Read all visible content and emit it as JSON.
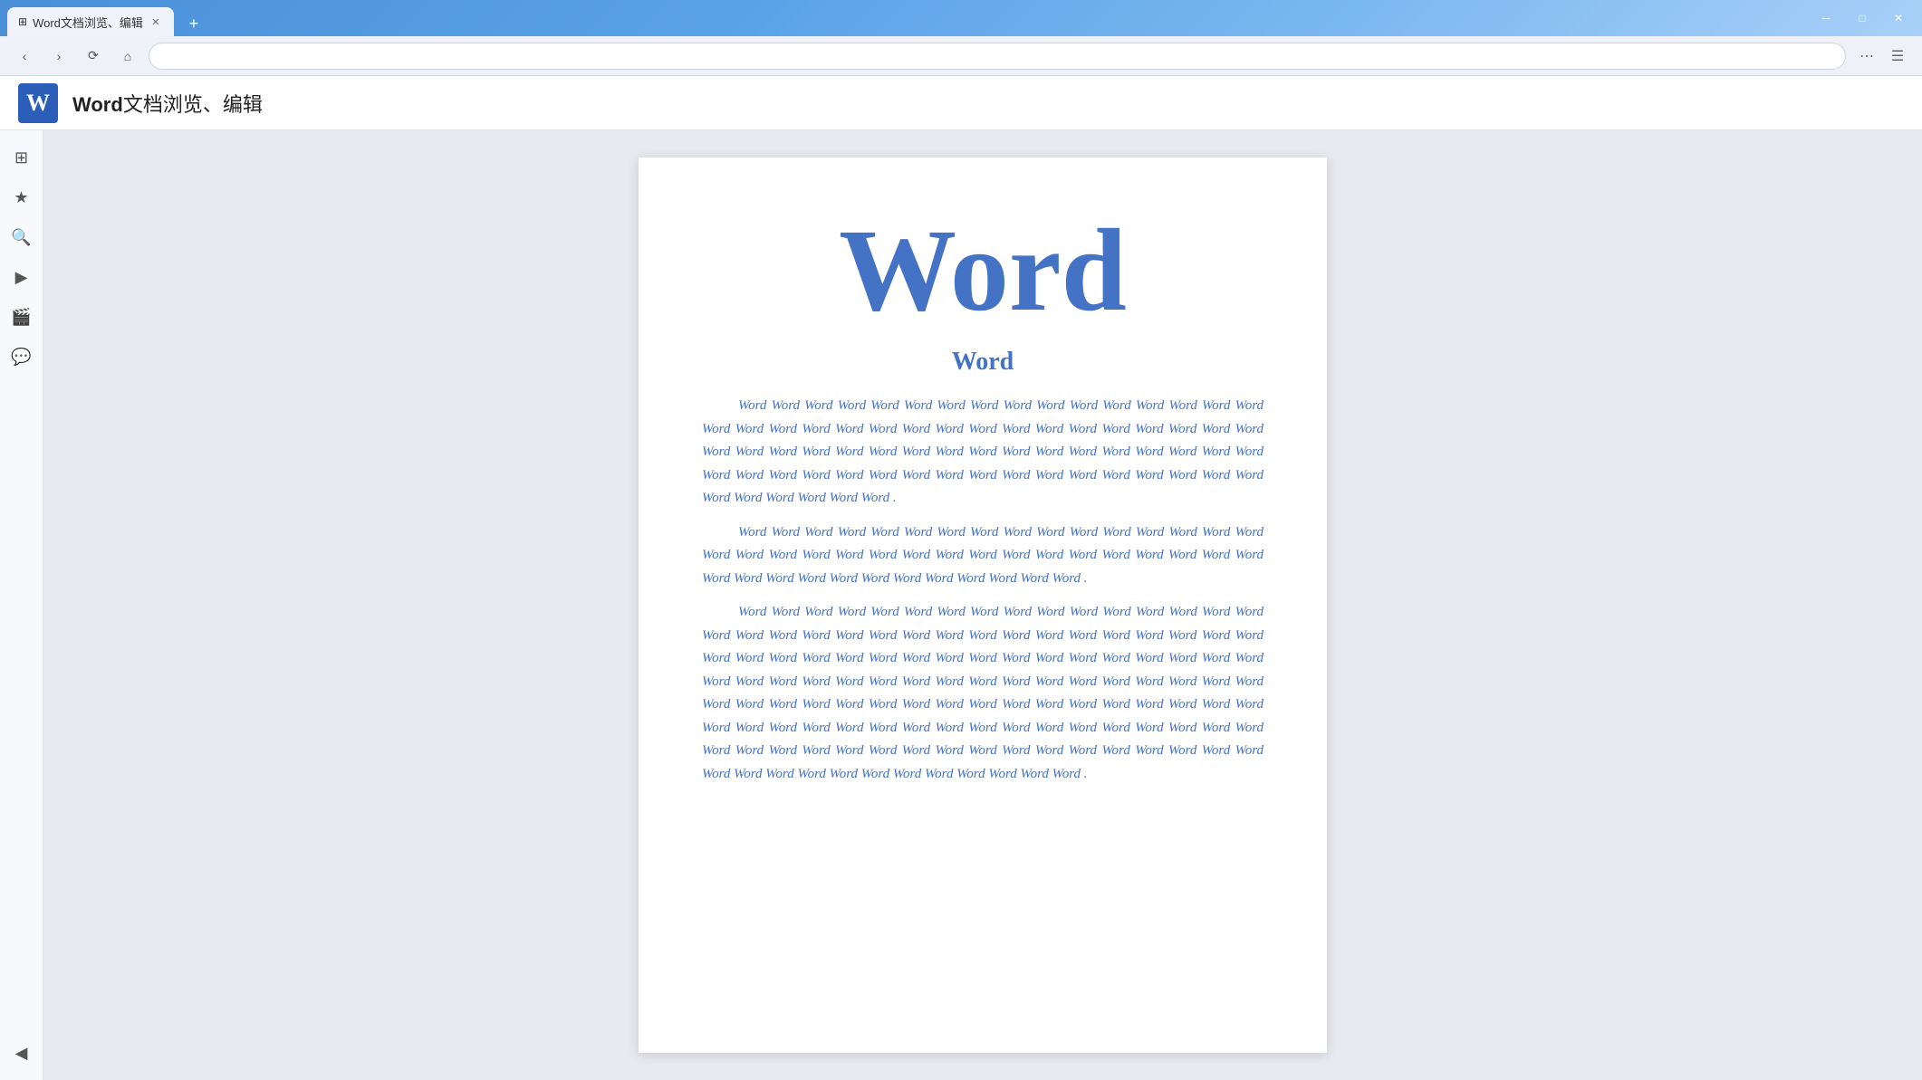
{
  "titlebar": {
    "tab_label": "Word文档浏览、编辑",
    "tab_icon": "⊞",
    "new_tab_label": "+",
    "minimize_label": "─",
    "maximize_label": "□",
    "close_label": "✕"
  },
  "navbar": {
    "back_label": "‹",
    "forward_label": "›",
    "refresh_label": "⟳",
    "home_label": "⌂",
    "address": "",
    "menu_label": "⋯",
    "hamburger_label": "☰"
  },
  "app_header": {
    "logo": "W",
    "title_bold": "Word",
    "title_rest": "文档浏览、编辑"
  },
  "sidebar": {
    "icons": [
      "⊞",
      "★",
      "🔍",
      "▶",
      "🎬",
      "💬"
    ]
  },
  "document": {
    "big_title": "Word",
    "subtitle": "Word",
    "paragraphs": [
      "Word Word Word Word Word Word Word Word Word Word Word Word Word Word Word Word Word Word Word Word Word Word Word Word Word Word Word Word Word Word Word Word Word Word Word Word Word Word Word Word Word Word Word Word Word Word Word Word Word Word Word Word Word Word Word Word Word Word Word Word Word Word Word Word Word Word Word Word Word Word Word Word Word .",
      "Word Word Word Word Word Word Word Word Word Word Word Word Word Word Word Word Word Word Word Word Word Word Word Word Word Word Word Word Word Word Word Word Word Word Word Word Word Word Word Word Word Word Word Word Word .",
      "Word Word Word Word Word Word Word Word Word Word Word Word Word Word Word Word Word Word Word Word Word Word Word Word Word Word Word Word Word Word Word Word Word Word Word Word Word Word Word Word Word Word Word Word Word Word Word Word Word Word Word Word Word Word Word Word Word Word Word Word Word Word Word Word Word Word Word Word Word Word Word Word Word Word Word Word Word Word Word Word Word Word Word Word Word Word Word Word Word Word Word Word Word Word Word Word Word Word Word Word Word Word Word Word Word Word Word Word Word Word Word Word Word Word Word Word Word Word Word Word Word Word Word Word Word Word Word Word Word Word ."
    ]
  },
  "colors": {
    "accent_blue": "#4472c4",
    "title_bg": "#4a90d9",
    "sidebar_bg": "#f8f9fc",
    "doc_bg": "#e8eaf0"
  }
}
